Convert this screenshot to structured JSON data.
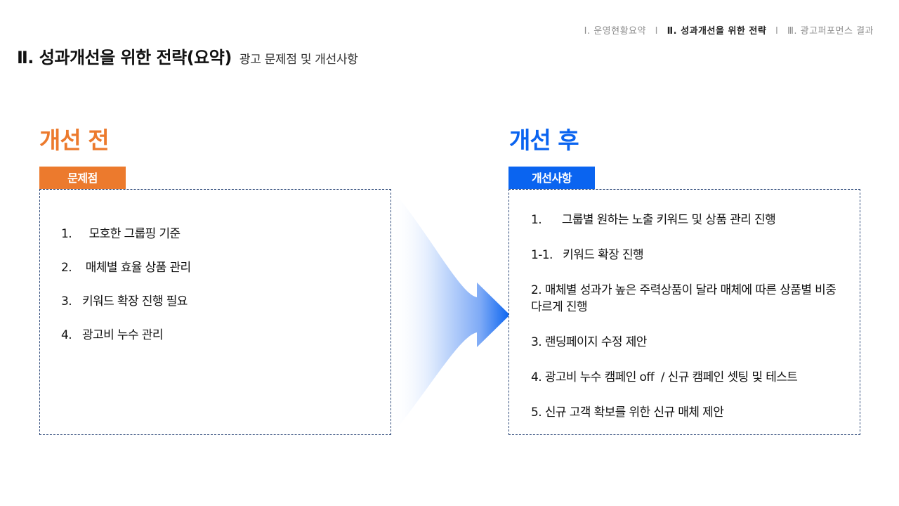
{
  "nav": {
    "item1": "Ⅰ. 운영현황요약",
    "sep1": "I",
    "item2": "Ⅱ. 성과개선을 위한 전략",
    "sep2": "I",
    "item3": "Ⅲ. 광고퍼포먼스 결과"
  },
  "header": {
    "title": "Ⅱ. 성과개선을 위한 전략(요약)",
    "subtitle": "광고 문제점 및 개선사항"
  },
  "before": {
    "heading": "개선 전",
    "tag": "문제점",
    "items": [
      {
        "num": "1.",
        "text": "  모호한 그룹핑 기준"
      },
      {
        "num": "2.",
        "text": " 매체별 효율 상품 관리"
      },
      {
        "num": "3.",
        "text": "키워드 확장 진행 필요"
      },
      {
        "num": "4.",
        "text": "광고비 누수 관리"
      }
    ]
  },
  "after": {
    "heading": "개선 후",
    "tag": "개선사항",
    "items": [
      "1.      그룹별 원하는 노출 키워드 및 상품 관리 진행",
      "1-1.   키워드 확장 진행",
      "2. 매체별 성과가 높은 주력상품이 달라 매체에 따른 상품별 비중 다르게 진행",
      "3. 랜딩페이지 수정 제안",
      "4. 광고비 누수 캠페인 off  / 신규 캠페인 셋팅 및 테스트",
      "5. 신규 고객 확보를 위한 신규 매체 제안"
    ]
  },
  "colors": {
    "before_accent": "#ec7a2d",
    "after_accent": "#0a64f0",
    "box_border": "#2f4a7a"
  },
  "icons": {
    "transition": "right-arrow-icon"
  }
}
